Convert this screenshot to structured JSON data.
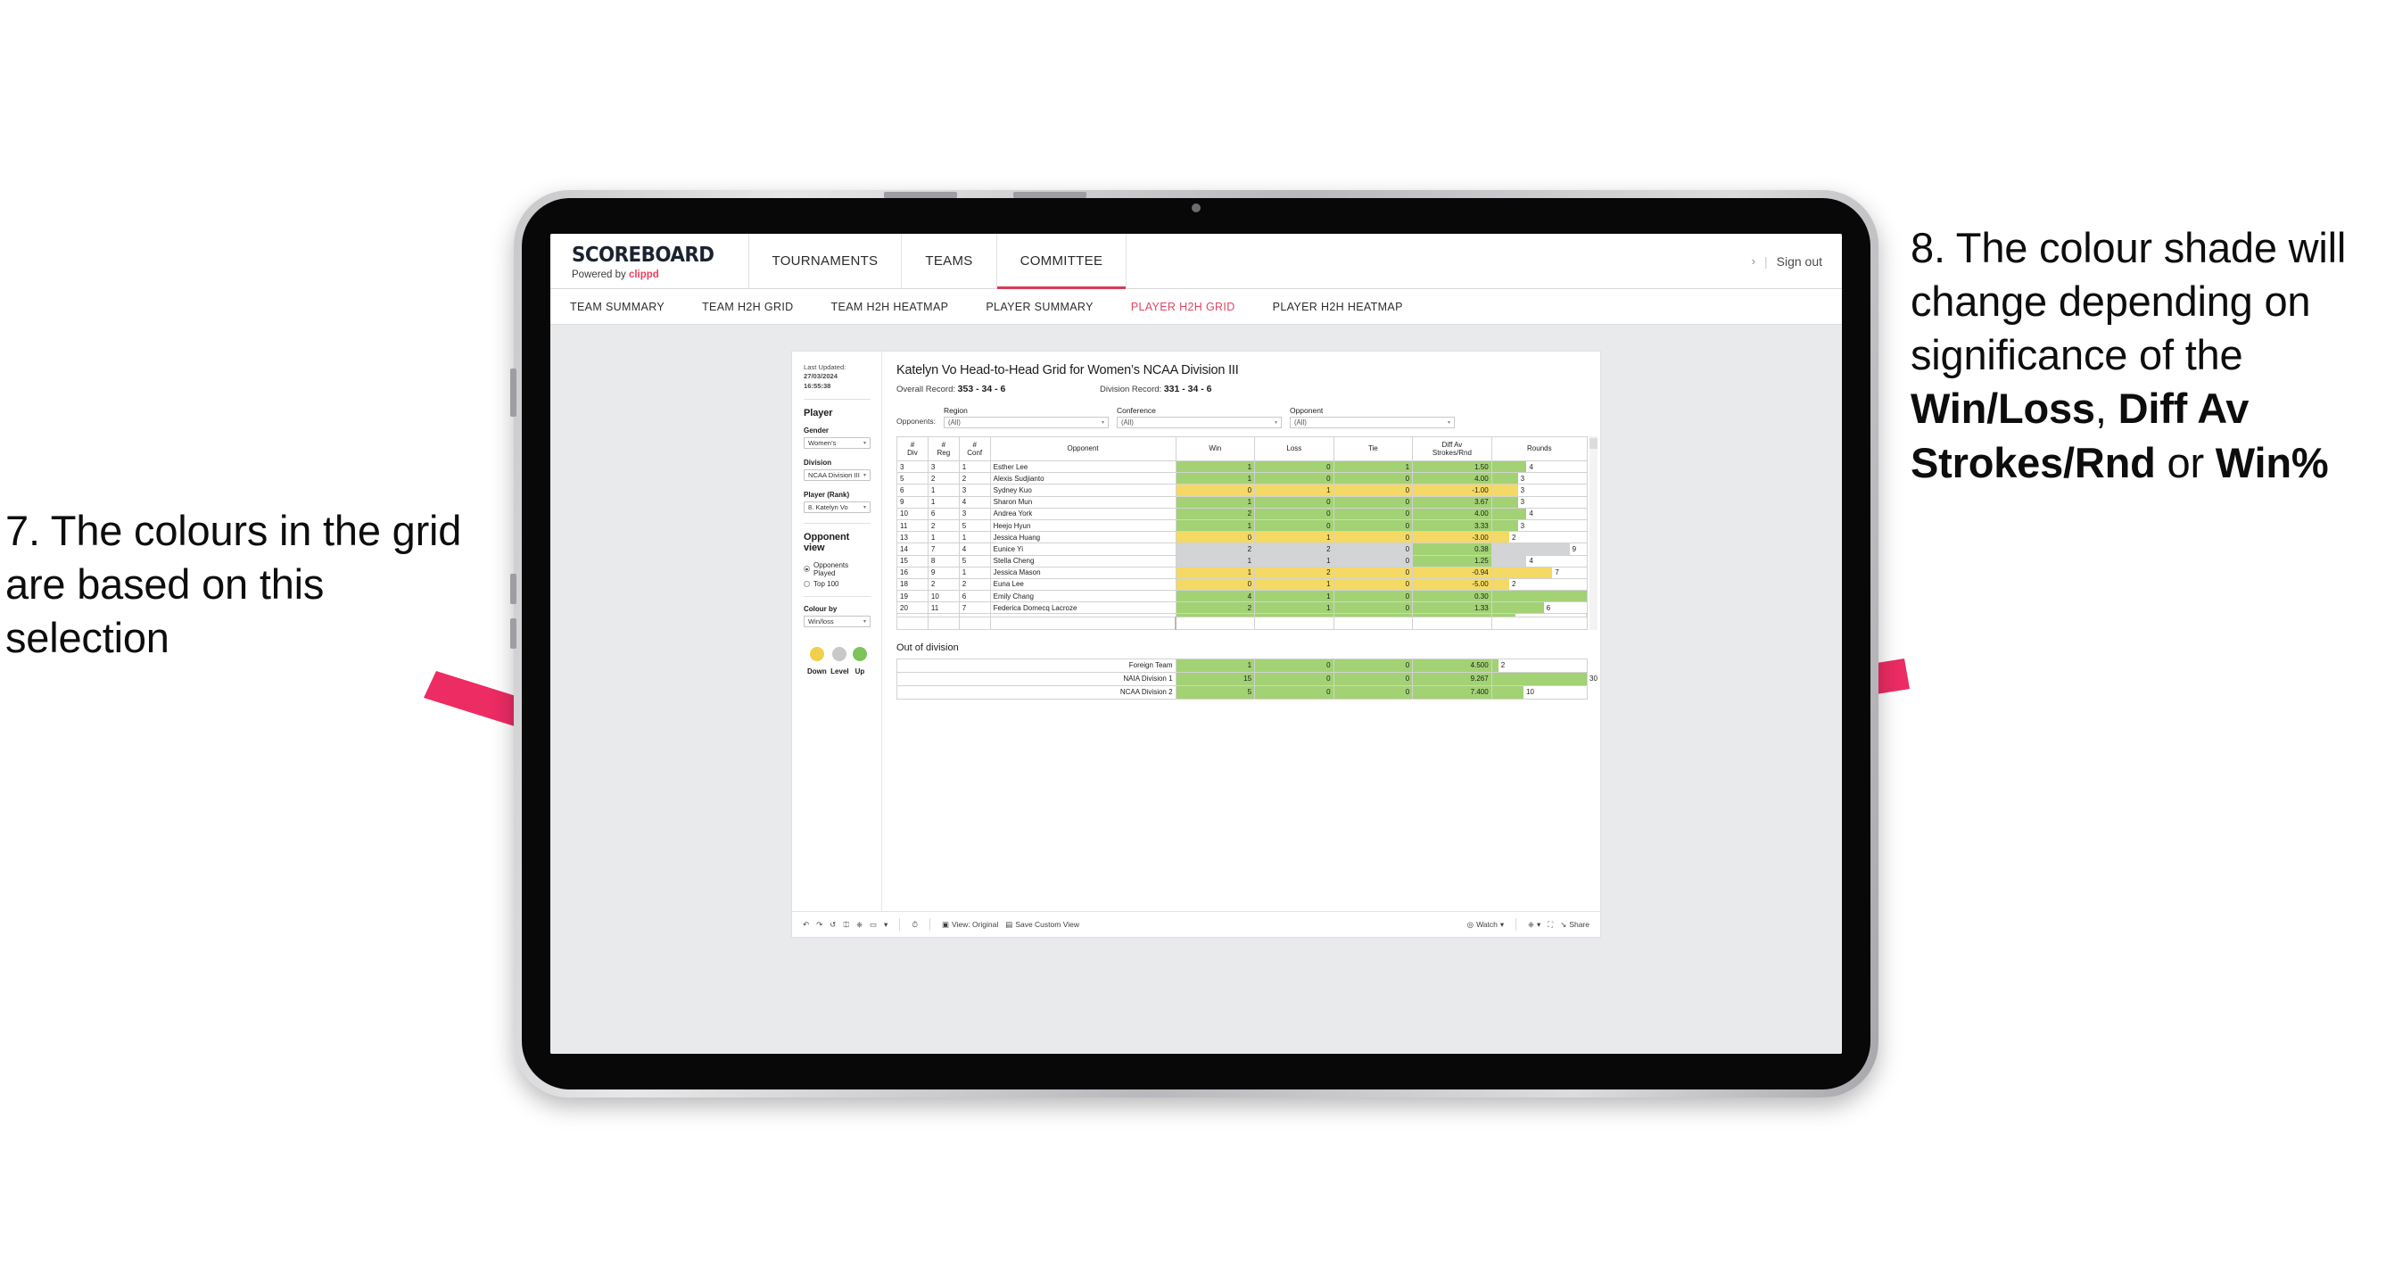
{
  "annotations": {
    "left": "7. The colours in the grid are based on this selection",
    "right_parts": [
      {
        "t": "8. The colour shade will change depending on significance of the ",
        "b": false
      },
      {
        "t": "Win/Loss",
        "b": true
      },
      {
        "t": ", ",
        "b": false
      },
      {
        "t": "Diff Av Strokes/Rnd",
        "b": true
      },
      {
        "t": " or ",
        "b": false
      },
      {
        "t": "Win%",
        "b": true
      }
    ],
    "arrow_color": "#ec2c63"
  },
  "app": {
    "brand": {
      "title": "SCOREBOARD",
      "sub_prefix": "Powered by ",
      "sub_brand": "clippd"
    },
    "mainnav": [
      {
        "label": "TOURNAMENTS",
        "active": false
      },
      {
        "label": "TEAMS",
        "active": false
      },
      {
        "label": "COMMITTEE",
        "active": true
      }
    ],
    "appbar_right": {
      "chevron": "›",
      "separator": "|",
      "signout": "Sign out"
    },
    "subnav": [
      {
        "label": "TEAM SUMMARY",
        "active": false
      },
      {
        "label": "TEAM H2H GRID",
        "active": false
      },
      {
        "label": "TEAM H2H HEATMAP",
        "active": false
      },
      {
        "label": "PLAYER SUMMARY",
        "active": false
      },
      {
        "label": "PLAYER H2H GRID",
        "active": true
      },
      {
        "label": "PLAYER H2H HEATMAP",
        "active": false
      }
    ]
  },
  "sidebar": {
    "last_updated_label": "Last Updated: ",
    "last_updated_date": "27/03/2024",
    "last_updated_time": "16:55:38",
    "player_section": "Player",
    "gender_label": "Gender",
    "gender_value": "Women’s",
    "division_label": "Division",
    "division_value": "NCAA Division III",
    "player_rank_label": "Player (Rank)",
    "player_rank_value": "8. Katelyn Vo",
    "opponent_view_label": "Opponent view",
    "opponent_view_options": [
      {
        "label": "Opponents Played",
        "selected": true
      },
      {
        "label": "Top 100",
        "selected": false
      }
    ],
    "colour_by_label": "Colour by",
    "colour_by_value": "Win/loss",
    "legend": [
      {
        "label": "Down",
        "color": "#f0cf4a"
      },
      {
        "label": "Level",
        "color": "#c6c8ca"
      },
      {
        "label": "Up",
        "color": "#7ec45a"
      }
    ]
  },
  "main": {
    "title": "Katelyn Vo Head-to-Head Grid for Women’s NCAA Division III",
    "overall_record_label": "Overall Record: ",
    "overall_record": "353 - 34 - 6",
    "division_record_label": "Division Record: ",
    "division_record": "331 - 34 - 6",
    "opponents_label": "Opponents:",
    "filters": [
      {
        "label": "Region",
        "value": "(All)"
      },
      {
        "label": "Conference",
        "value": "(All)"
      },
      {
        "label": "Opponent",
        "value": "(All)"
      }
    ],
    "out_of_division_title": "Out of division"
  },
  "chart_data": {
    "type": "table",
    "title": "Katelyn Vo Head-to-Head Grid for Women’s NCAA Division III",
    "columns": [
      "# Div",
      "# Reg",
      "# Conf",
      "Opponent",
      "Win",
      "Loss",
      "Tie",
      "Diff Av Strokes/Rnd",
      "Rounds"
    ],
    "column_headers_two_line": [
      {
        "l1": "#",
        "l2": "Div"
      },
      {
        "l1": "#",
        "l2": "Reg"
      },
      {
        "l1": "#",
        "l2": "Conf"
      },
      {
        "l1": "Opponent",
        "l2": ""
      },
      {
        "l1": "Win",
        "l2": ""
      },
      {
        "l1": "Loss",
        "l2": ""
      },
      {
        "l1": "Tie",
        "l2": ""
      },
      {
        "l1": "Diff Av",
        "l2": "Strokes/Rnd"
      },
      {
        "l1": "Rounds",
        "l2": ""
      }
    ],
    "colors": {
      "up": "#a2d274",
      "down": "#f4d964",
      "level": "#d2d4d6",
      "white": "#ffffff"
    },
    "rounds_max": 11,
    "rows": [
      {
        "div": "3",
        "reg": "3",
        "conf": "1",
        "opponent": "Esther Lee",
        "win": "1",
        "loss": "0",
        "tie": "1",
        "diff": "1.50",
        "rounds": "4",
        "state": "up"
      },
      {
        "div": "5",
        "reg": "2",
        "conf": "2",
        "opponent": "Alexis Sudjianto",
        "win": "1",
        "loss": "0",
        "tie": "0",
        "diff": "4.00",
        "rounds": "3",
        "state": "up"
      },
      {
        "div": "6",
        "reg": "1",
        "conf": "3",
        "opponent": "Sydney Kuo",
        "win": "0",
        "loss": "1",
        "tie": "0",
        "diff": "-1.00",
        "rounds": "3",
        "state": "down"
      },
      {
        "div": "9",
        "reg": "1",
        "conf": "4",
        "opponent": "Sharon Mun",
        "win": "1",
        "loss": "0",
        "tie": "0",
        "diff": "3.67",
        "rounds": "3",
        "state": "up"
      },
      {
        "div": "10",
        "reg": "6",
        "conf": "3",
        "opponent": "Andrea York",
        "win": "2",
        "loss": "0",
        "tie": "0",
        "diff": "4.00",
        "rounds": "4",
        "state": "up"
      },
      {
        "div": "11",
        "reg": "2",
        "conf": "5",
        "opponent": "Heejo Hyun",
        "win": "1",
        "loss": "0",
        "tie": "0",
        "diff": "3.33",
        "rounds": "3",
        "state": "up"
      },
      {
        "div": "13",
        "reg": "1",
        "conf": "1",
        "opponent": "Jessica Huang",
        "win": "0",
        "loss": "1",
        "tie": "0",
        "diff": "-3.00",
        "rounds": "2",
        "state": "down"
      },
      {
        "div": "14",
        "reg": "7",
        "conf": "4",
        "opponent": "Eunice Yi",
        "win": "2",
        "loss": "2",
        "tie": "0",
        "diff": "0.38",
        "rounds": "9",
        "state": "level",
        "diff_state": "up"
      },
      {
        "div": "15",
        "reg": "8",
        "conf": "5",
        "opponent": "Stella Cheng",
        "win": "1",
        "loss": "1",
        "tie": "0",
        "diff": "1.25",
        "rounds": "4",
        "state": "level",
        "diff_state": "up"
      },
      {
        "div": "16",
        "reg": "9",
        "conf": "1",
        "opponent": "Jessica Mason",
        "win": "1",
        "loss": "2",
        "tie": "0",
        "diff": "-0.94",
        "rounds": "7",
        "state": "down"
      },
      {
        "div": "18",
        "reg": "2",
        "conf": "2",
        "opponent": "Euna Lee",
        "win": "0",
        "loss": "1",
        "tie": "0",
        "diff": "-5.00",
        "rounds": "2",
        "state": "down"
      },
      {
        "div": "19",
        "reg": "10",
        "conf": "6",
        "opponent": "Emily Chang",
        "win": "4",
        "loss": "1",
        "tie": "0",
        "diff": "0.30",
        "rounds": "11",
        "state": "up"
      },
      {
        "div": "20",
        "reg": "11",
        "conf": "7",
        "opponent": "Federica Domecq Lacroze",
        "win": "2",
        "loss": "1",
        "tie": "0",
        "diff": "1.33",
        "rounds": "6",
        "state": "up"
      }
    ],
    "out_of_division": {
      "rounds_max": 30,
      "rows": [
        {
          "name": "Foreign Team",
          "win": "1",
          "loss": "0",
          "tie": "0",
          "diff": "4.500",
          "rounds": "2",
          "state": "up"
        },
        {
          "name": "NAIA Division 1",
          "win": "15",
          "loss": "0",
          "tie": "0",
          "diff": "9.267",
          "rounds": "30",
          "state": "up"
        },
        {
          "name": "NCAA Division 2",
          "win": "5",
          "loss": "0",
          "tie": "0",
          "diff": "7.400",
          "rounds": "10",
          "state": "up"
        }
      ]
    }
  },
  "toolbar": {
    "undo": "↶",
    "redo": "↷",
    "revert": "↺",
    "refresh": "⥁",
    "pause": "⏸",
    "view_label": "View: Original",
    "save_custom_view": "Save Custom View",
    "watch": "Watch",
    "share": "Share",
    "caret": "▾"
  }
}
